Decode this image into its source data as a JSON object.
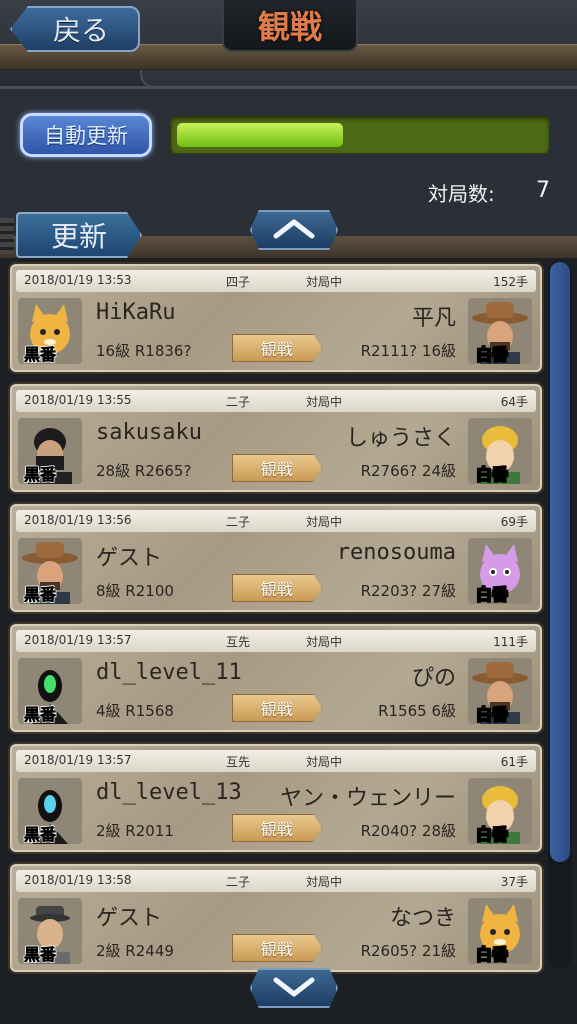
{
  "header": {
    "back_label": "戻る",
    "title": "観戦"
  },
  "controls": {
    "auto_update_label": "自動更新",
    "progress_fraction": 0.45,
    "game_count_label": "対局数:",
    "game_count_value": "7",
    "update_label": "更新"
  },
  "colors": {
    "progress_fill": "#9fe032",
    "accent_blue": "#2f55a8",
    "title_orange": "#e07b4a"
  },
  "games": [
    {
      "datetime": "2018/01/19 13:53",
      "handicap": "四子",
      "status": "対局中",
      "moves": "152手",
      "black_name": "HiKaRu",
      "black_rank": "16級 R1836?",
      "white_name": "平凡",
      "white_rank": "R2111? 16級",
      "watch_label": "観戦",
      "black_tag": "黒番",
      "white_tag": "白番",
      "black_avatar": "cat-icon",
      "white_avatar": "cowboy-icon"
    },
    {
      "datetime": "2018/01/19 13:55",
      "handicap": "二子",
      "status": "対局中",
      "moves": "64手",
      "black_name": "sakusaku",
      "black_rank": "28級 R2665?",
      "white_name": "しゅうさく",
      "white_rank": "R2766? 24級",
      "watch_label": "観戦",
      "black_tag": "黒番",
      "white_tag": "白番",
      "black_avatar": "ninja-icon",
      "white_avatar": "blond-man-icon"
    },
    {
      "datetime": "2018/01/19 13:56",
      "handicap": "二子",
      "status": "対局中",
      "moves": "69手",
      "black_name": "ゲスト",
      "black_rank": "8級 R2100",
      "white_name": "renosouma",
      "white_rank": "R2203? 27級",
      "watch_label": "観戦",
      "black_tag": "黒番",
      "white_tag": "白番",
      "black_avatar": "cowboy-icon",
      "white_avatar": "pink-cat-icon"
    },
    {
      "datetime": "2018/01/19 13:57",
      "handicap": "互先",
      "status": "対局中",
      "moves": "111手",
      "black_name": "dl_level_11",
      "black_rank": "4級 R1568",
      "white_name": "ぴの",
      "white_rank": "R1565 6級",
      "watch_label": "観戦",
      "black_tag": "黒番",
      "white_tag": "白番",
      "black_avatar": "robot-green-icon",
      "white_avatar": "cowboy-icon"
    },
    {
      "datetime": "2018/01/19 13:57",
      "handicap": "互先",
      "status": "対局中",
      "moves": "61手",
      "black_name": "dl_level_13",
      "black_rank": "2級 R2011",
      "white_name": "ヤン・ウェンリー",
      "white_rank": "R2040? 28級",
      "watch_label": "観戦",
      "black_tag": "黒番",
      "white_tag": "白番",
      "black_avatar": "robot-blue-icon",
      "white_avatar": "blond-man-icon"
    },
    {
      "datetime": "2018/01/19 13:58",
      "handicap": "二子",
      "status": "対局中",
      "moves": "37手",
      "black_name": "ゲスト",
      "black_rank": "2級 R2449",
      "white_name": "なつき",
      "white_rank": "R2605? 21級",
      "watch_label": "観戦",
      "black_tag": "黒番",
      "white_tag": "白番",
      "black_avatar": "hat-man-icon",
      "white_avatar": "cat-icon"
    }
  ]
}
